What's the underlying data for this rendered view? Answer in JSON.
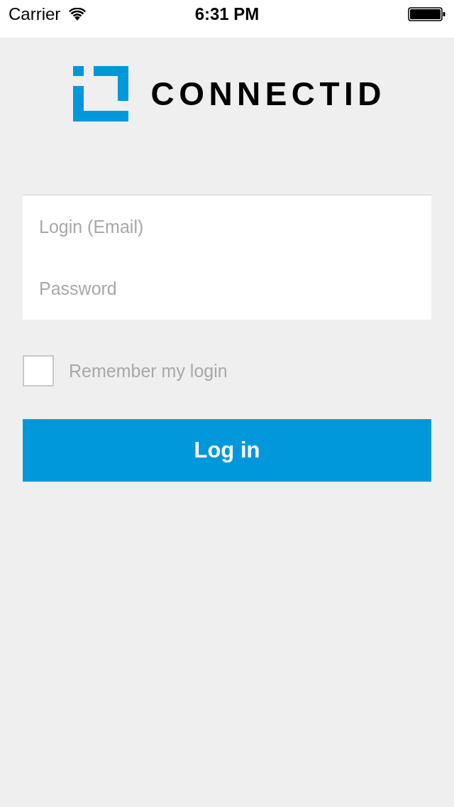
{
  "status_bar": {
    "carrier": "Carrier",
    "time": "6:31 PM"
  },
  "logo": {
    "wordmark": "CONNECTID"
  },
  "form": {
    "fields": [
      {
        "placeholder": "Login (Email)"
      },
      {
        "placeholder": "Password"
      }
    ]
  },
  "remember": {
    "label": "Remember my login",
    "checked": false
  },
  "login_button": {
    "label": "Log in"
  }
}
